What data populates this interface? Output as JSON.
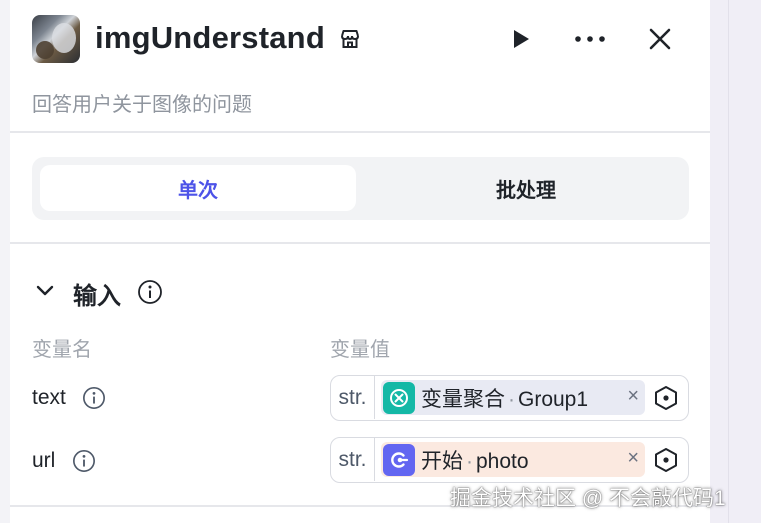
{
  "header": {
    "title": "imgUnderstand",
    "description": "回答用户关于图像的问题"
  },
  "icons": {
    "avatar": "plugin-image-avatar",
    "store": "store-icon",
    "run": "play-icon",
    "more": "more-icon",
    "close": "close-icon"
  },
  "tabs": {
    "single": "单次",
    "batch": "批处理"
  },
  "input_section": {
    "title": "输入",
    "col_name": "变量名",
    "col_value": "变量值",
    "rows": [
      {
        "name": "text",
        "type": "str.",
        "source_node": "变量聚合",
        "source_var": "Group1",
        "chip_color": "#e8eaf3",
        "icon_color": "#14b8a6",
        "remove": "×"
      },
      {
        "name": "url",
        "type": "str.",
        "source_node": "开始",
        "source_var": "photo",
        "chip_color": "#fbe9e0",
        "icon_color": "#6366f1",
        "remove": "×"
      }
    ]
  },
  "watermark": "掘金技术社区 @ 不会敲代码1",
  "colors": {
    "accent": "#4d53e8",
    "muted_text": "#8f959e"
  }
}
